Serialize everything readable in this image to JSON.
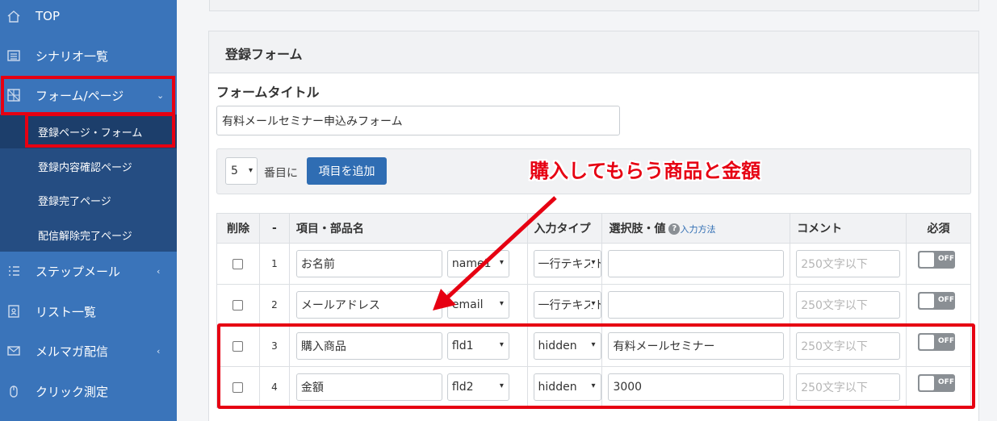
{
  "sidebar": {
    "items": [
      {
        "label": "TOP",
        "icon": "home-icon"
      },
      {
        "label": "シナリオ一覧",
        "icon": "list-icon"
      },
      {
        "label": "フォーム/ページ",
        "icon": "grid-icon",
        "chevron": "⌄"
      },
      {
        "label": "ステップメール",
        "icon": "steps-icon",
        "chevron": "‹"
      },
      {
        "label": "リスト一覧",
        "icon": "user-list-icon"
      },
      {
        "label": "メルマガ配信",
        "icon": "mail-icon",
        "chevron": "‹"
      },
      {
        "label": "クリック測定",
        "icon": "mouse-icon"
      }
    ],
    "sub_items": [
      {
        "label": "登録ページ・フォーム"
      },
      {
        "label": "登録内容確認ページ"
      },
      {
        "label": "登録完了ページ"
      },
      {
        "label": "配信解除完了ページ"
      }
    ]
  },
  "card": {
    "heading": "登録フォーム",
    "form_title_label": "フォームタイトル",
    "form_title_value": "有料メールセミナー申込みフォーム"
  },
  "toolbar": {
    "position_value": "5",
    "position_suffix": "番目に",
    "add_button": "項目を追加"
  },
  "table": {
    "headers": {
      "delete": "削除",
      "index": "-",
      "item": "項目・部品名",
      "type": "入力タイプ",
      "choices": "選択肢・値",
      "help_link": "入力方法",
      "comment": "コメント",
      "required": "必須"
    },
    "comment_placeholder": "250文字以下",
    "toggle_label": "OFF",
    "rows": [
      {
        "num": "1",
        "name": "お名前",
        "field": "name1",
        "type": "一行テキスト",
        "value": ""
      },
      {
        "num": "2",
        "name": "メールアドレス",
        "field": "email",
        "type": "一行テキスト",
        "value": ""
      },
      {
        "num": "3",
        "name": "購入商品",
        "field": "fld1",
        "type": "hidden",
        "value": "有料メールセミナー"
      },
      {
        "num": "4",
        "name": "金額",
        "field": "fld2",
        "type": "hidden",
        "value": "3000"
      }
    ]
  },
  "annotation": {
    "text": "購入してもらう商品と金額",
    "color": "#e60012"
  },
  "colors": {
    "sidebar": "#3a74ba",
    "sidebar_sub": "#254d82",
    "primary_button": "#2f6db3",
    "highlight": "#e60012"
  }
}
